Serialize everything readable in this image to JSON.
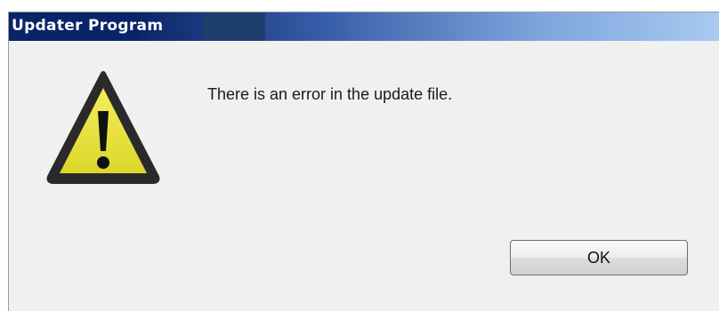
{
  "window": {
    "title": "Updater Program"
  },
  "dialog": {
    "icon": "warning-triangle-icon",
    "message": "There is an error in the update file.",
    "ok_label": "OK"
  },
  "colors": {
    "titlebar_start": "#0a246a",
    "titlebar_end": "#a6caf0",
    "warning_fill": "#e8e33a",
    "warning_border": "#2a2a2a",
    "dialog_background": "#f0f0f0"
  }
}
